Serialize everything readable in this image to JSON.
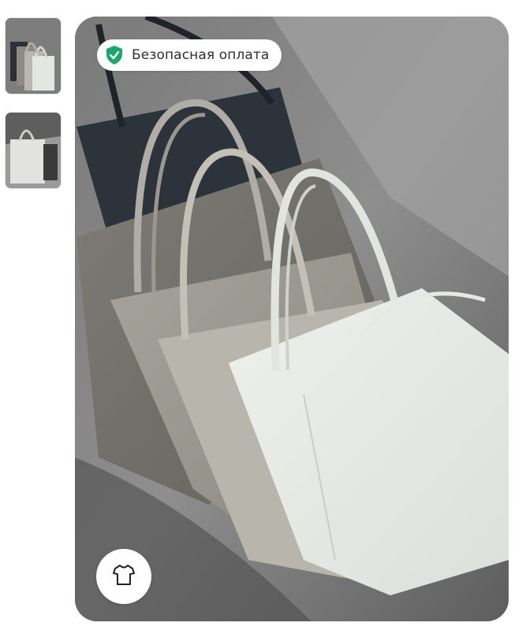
{
  "gallery": {
    "thumbnails": [
      {
        "name": "thumbnail-1",
        "icon": "bags-photo"
      },
      {
        "name": "thumbnail-2",
        "icon": "bag-photo"
      }
    ]
  },
  "badge": {
    "label": "Безопасная оплата",
    "icon": "shield-check-icon",
    "icon_color": "#1aa86a"
  },
  "size_button": {
    "icon": "tshirt-icon"
  },
  "colors": {
    "background": "#ffffff",
    "badge_bg": "#ffffff",
    "accent_green": "#1aa86a"
  }
}
